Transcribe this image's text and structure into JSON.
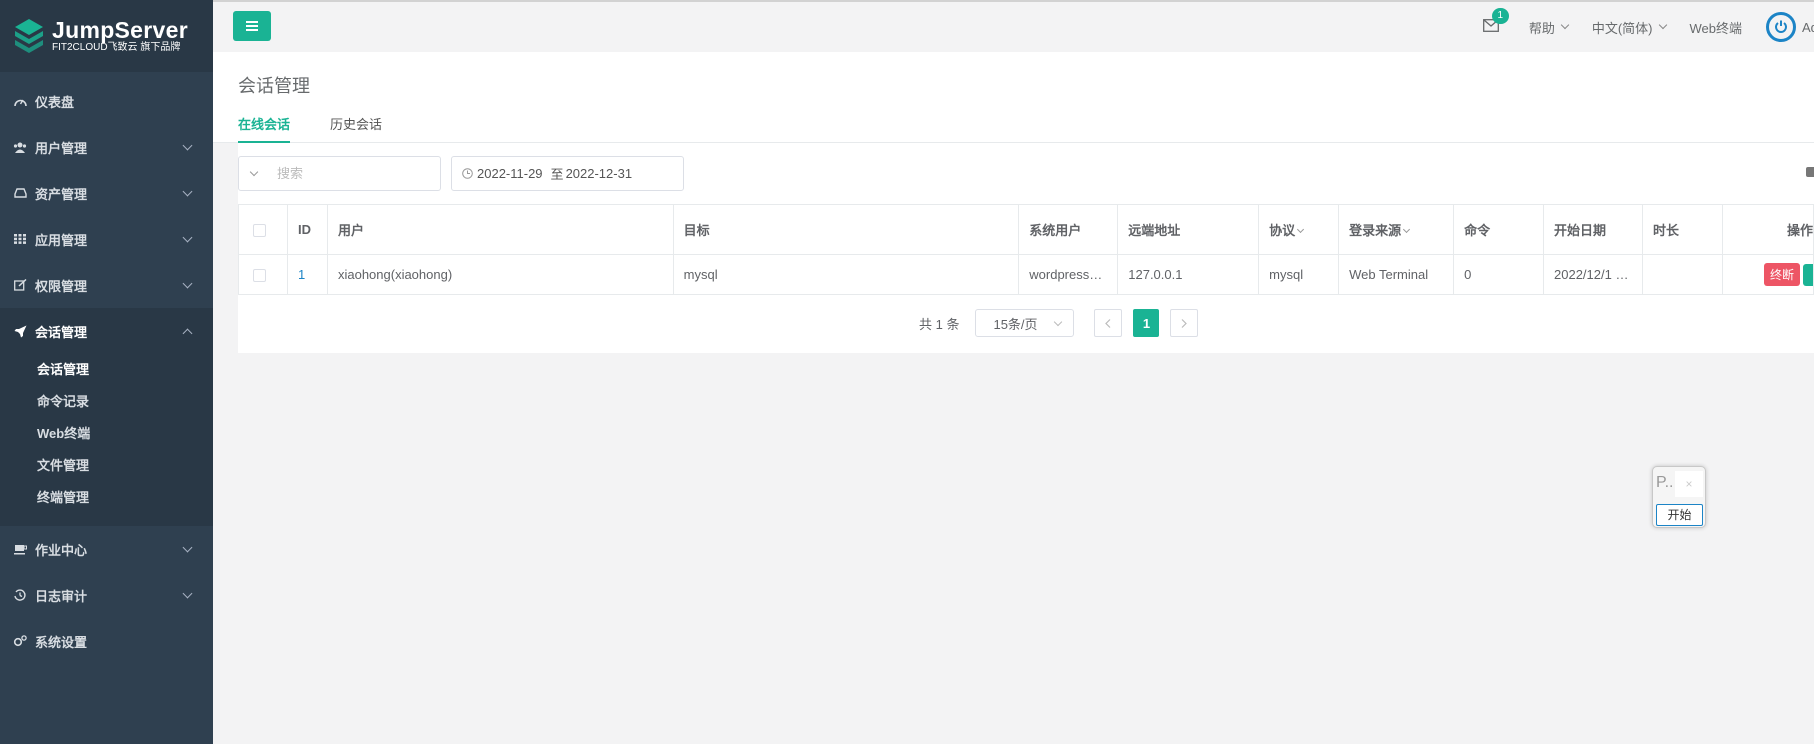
{
  "brand": {
    "name": "JumpServer",
    "tagline": "FIT2CLOUD飞致云 旗下品牌",
    "accent": "#1ab394"
  },
  "sidebar": {
    "items": [
      {
        "label": "仪表盘",
        "icon": "dashboard-icon"
      },
      {
        "label": "用户管理",
        "icon": "users-icon"
      },
      {
        "label": "资产管理",
        "icon": "drive-icon"
      },
      {
        "label": "应用管理",
        "icon": "grid-icon"
      },
      {
        "label": "权限管理",
        "icon": "edit-icon"
      }
    ],
    "active_group": {
      "label": "会话管理",
      "icon": "rocket-icon",
      "children": [
        "会话管理",
        "命令记录",
        "Web终端",
        "文件管理",
        "终端管理"
      ]
    },
    "bottom_items": [
      {
        "label": "作业中心",
        "icon": "coffee-icon"
      },
      {
        "label": "日志审计",
        "icon": "history-icon"
      },
      {
        "label": "系统设置",
        "icon": "cogs-icon"
      }
    ]
  },
  "topbar": {
    "mail_count": "1",
    "help": "帮助",
    "language": "中文(简体)",
    "web_terminal": "Web终端",
    "user_name": "Administrator"
  },
  "page": {
    "title": "会话管理",
    "tabs": [
      "在线会话",
      "历史会话"
    ]
  },
  "filters": {
    "search_placeholder": "搜索",
    "date_from": "2022-11-29",
    "date_sep": "至",
    "date_to": "2022-12-31"
  },
  "table": {
    "headers": [
      "ID",
      "用户",
      "目标",
      "系统用户",
      "远端地址",
      "协议",
      "登录来源",
      "命令",
      "开始日期",
      "时长",
      "操作"
    ],
    "rows": [
      {
        "id": "1",
        "user": "xiaohong(xiaohong)",
        "target": "mysql",
        "system_user": "wordpress…",
        "remote_addr": "127.0.0.1",
        "protocol": "mysql",
        "login_from": "Web Terminal",
        "command": "0",
        "date_start": "2022/12/1 …",
        "duration": "",
        "action_kill": "终断"
      }
    ]
  },
  "pagination": {
    "total": "共 1 条",
    "page_size": "15条/页",
    "current": "1"
  },
  "float_widget": {
    "text": "P..",
    "close": "×",
    "start": "开始"
  }
}
